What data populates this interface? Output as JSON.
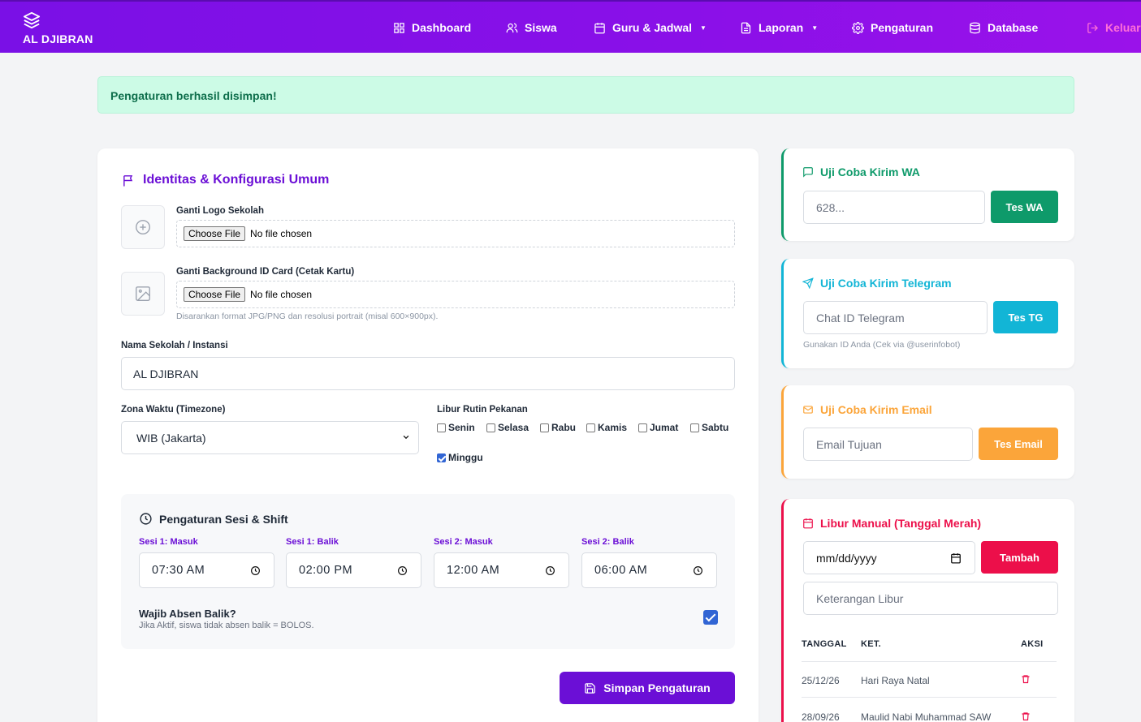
{
  "brand": {
    "name": "AL DJIBRAN"
  },
  "nav": {
    "dashboard": "Dashboard",
    "siswa": "Siswa",
    "guru_jadwal": "Guru & Jadwal",
    "laporan": "Laporan",
    "pengaturan": "Pengaturan",
    "database": "Database",
    "keluar": "Keluar"
  },
  "alert": {
    "message": "Pengaturan berhasil disimpan!"
  },
  "identity": {
    "title": "Identitas & Konfigurasi Umum",
    "logo_label": "Ganti Logo Sekolah",
    "bg_label": "Ganti Background ID Card (Cetak Kartu)",
    "file_button": "Choose File",
    "file_status": "No file chosen",
    "bg_hint": "Disarankan format JPG/PNG dan resolusi portrait (misal 600×900px).",
    "school_label": "Nama Sekolah / Instansi",
    "school_value": "AL DJIBRAN",
    "timezone_label": "Zona Waktu (Timezone)",
    "timezone_value": "WIB (Jakarta)",
    "holiday_label": "Libur Rutin Pekanan",
    "days": [
      {
        "label": "Senin",
        "checked": false
      },
      {
        "label": "Selasa",
        "checked": false
      },
      {
        "label": "Rabu",
        "checked": false
      },
      {
        "label": "Kamis",
        "checked": false
      },
      {
        "label": "Jumat",
        "checked": false
      },
      {
        "label": "Sabtu",
        "checked": false
      },
      {
        "label": "Minggu",
        "checked": true
      }
    ]
  },
  "session": {
    "title": "Pengaturan Sesi & Shift",
    "s1_in_label": "Sesi 1: Masuk",
    "s1_in_value": "07:30 AM",
    "s1_out_label": "Sesi 1: Balik",
    "s1_out_value": "02:00 PM",
    "s2_in_label": "Sesi 2: Masuk",
    "s2_in_value": "12:00 AM",
    "s2_out_label": "Sesi 2: Balik",
    "s2_out_value": "06:00 AM",
    "wajib_label": "Wajib Absen Balik?",
    "wajib_hint": "Jika Aktif, siswa tidak absen balik = BOLOS.",
    "wajib_checked": true
  },
  "save_button": "Simpan Pengaturan",
  "wa": {
    "title": "Uji Coba Kirim WA",
    "placeholder": "628...",
    "button": "Tes WA",
    "color": "#0e9a6a"
  },
  "tg": {
    "title": "Uji Coba Kirim Telegram",
    "placeholder": "Chat ID Telegram",
    "button": "Tes TG",
    "hint": "Gunakan ID Anda (Cek via @userinfobot)",
    "color": "#12b5d6"
  },
  "email": {
    "title": "Uji Coba Kirim Email",
    "placeholder": "Email Tujuan",
    "button": "Tes Email",
    "color": "#fba53a"
  },
  "holiday": {
    "title": "Libur Manual (Tanggal Merah)",
    "date_placeholder": "mm/dd/yyyy",
    "add_button": "Tambah",
    "note_placeholder": "Keterangan Libur",
    "col_date": "TANGGAL",
    "col_note": "KET.",
    "col_action": "AKSI",
    "rows": [
      {
        "date": "25/12/26",
        "note": "Hari Raya Natal"
      },
      {
        "date": "28/09/26",
        "note": "Maulid Nabi Muhammad SAW"
      }
    ],
    "color": "#ec0f4a"
  }
}
